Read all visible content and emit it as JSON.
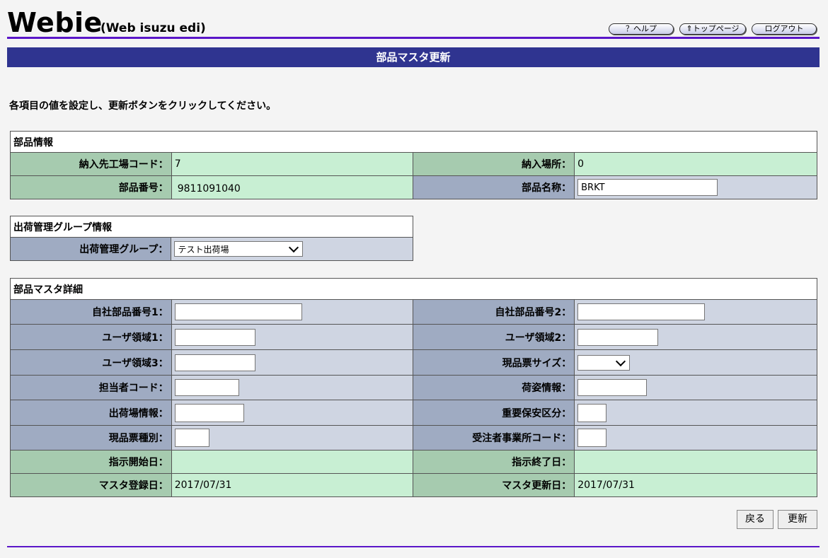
{
  "header": {
    "logo": "Webie",
    "logo_sub": "(Web isuzu edi)",
    "help_label": "？ヘルプ",
    "top_label": "⇑トップページ",
    "logout_label": "ログアウト"
  },
  "page_title": "部品マスタ更新",
  "instruction": "各項目の値を設定し、更新ボタンをクリックしてください。",
  "parts_info": {
    "section_title": "部品情報",
    "factory_code_label": "納入先工場コード：",
    "factory_code_value": "7",
    "delivery_place_label": "納入場所：",
    "delivery_place_value": "0",
    "part_number_label": "部品番号：",
    "part_number_value": "9811091040",
    "part_name_label": "部品名称：",
    "part_name_value": "BRKT"
  },
  "shipping_group": {
    "section_title": "出荷管理グループ情報",
    "group_label": "出荷管理グループ：",
    "group_selected": "テスト出荷場"
  },
  "details": {
    "section_title": "部品マスタ詳細",
    "own_part_no1_label": "自社部品番号1：",
    "own_part_no2_label": "自社部品番号2：",
    "user_area1_label": "ユーザ領域1：",
    "user_area2_label": "ユーザ領域2：",
    "user_area3_label": "ユーザ領域3：",
    "ticket_size_label": "現品票サイズ：",
    "person_code_label": "担当者コード：",
    "packing_info_label": "荷姿情報：",
    "ship_place_info_label": "出荷場情報：",
    "security_class_label": "重要保安区分：",
    "ticket_type_label": "現品票種別：",
    "office_code_label": "受注者事業所コード：",
    "start_date_label": "指示開始日：",
    "start_date_value": "",
    "end_date_label": "指示終了日：",
    "end_date_value": "",
    "reg_date_label": "マスタ登録日：",
    "reg_date_value": "2017/07/31",
    "upd_date_label": "マスタ更新日：",
    "upd_date_value": "2017/07/31"
  },
  "buttons": {
    "back_label": "戻る",
    "update_label": "更新"
  }
}
